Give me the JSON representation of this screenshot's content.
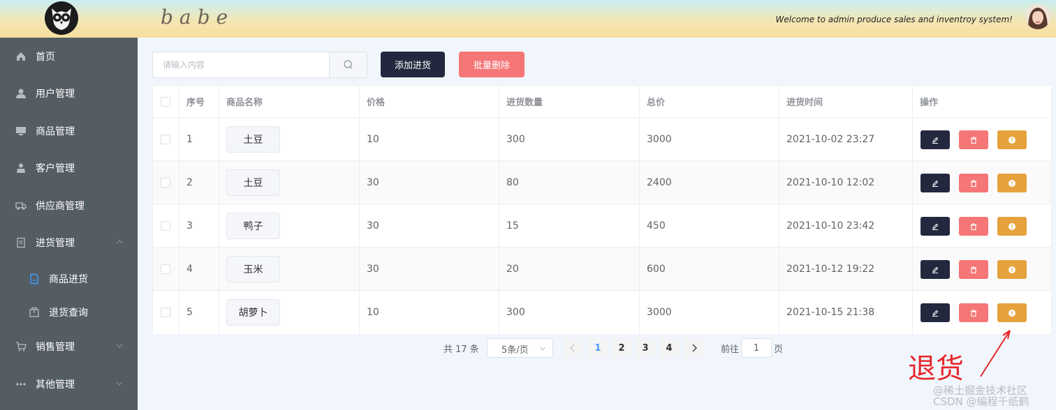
{
  "header": {
    "brand": "babe",
    "welcome": "Welcome to admin produce sales and inventroy system!"
  },
  "sidebar": {
    "items": [
      {
        "label": "首页",
        "icon": "home-icon"
      },
      {
        "label": "用户管理",
        "icon": "user-icon"
      },
      {
        "label": "商品管理",
        "icon": "monitor-icon"
      },
      {
        "label": "客户管理",
        "icon": "customer-icon"
      },
      {
        "label": "供应商管理",
        "icon": "truck-icon"
      },
      {
        "label": "进货管理",
        "icon": "document-icon",
        "expanded": true,
        "children": [
          {
            "label": "商品进货",
            "icon": "file-icon",
            "active": true
          },
          {
            "label": "退货查询",
            "icon": "box-icon"
          }
        ]
      },
      {
        "label": "销售管理",
        "icon": "cart-icon"
      },
      {
        "label": "其他管理",
        "icon": "more-icon"
      }
    ]
  },
  "toolbar": {
    "search_placeholder": "请输入内容",
    "add_label": "添加进货",
    "delete_label": "批量删除"
  },
  "table": {
    "headers": [
      "序号",
      "商品名称",
      "价格",
      "进货数量",
      "总价",
      "进货时间",
      "操作"
    ],
    "rows": [
      {
        "index": "1",
        "name": "土豆",
        "price": "10",
        "quantity": "300",
        "total": "3000",
        "time": "2021-10-02 23:27"
      },
      {
        "index": "2",
        "name": "土豆",
        "price": "30",
        "quantity": "80",
        "total": "2400",
        "time": "2021-10-10 12:02"
      },
      {
        "index": "3",
        "name": "鸭子",
        "price": "30",
        "quantity": "15",
        "total": "450",
        "time": "2021-10-10 23:42"
      },
      {
        "index": "4",
        "name": "玉米",
        "price": "30",
        "quantity": "20",
        "total": "600",
        "time": "2021-10-12 19:22"
      },
      {
        "index": "5",
        "name": "胡萝卜",
        "price": "10",
        "quantity": "300",
        "total": "3000",
        "time": "2021-10-15 21:38"
      }
    ]
  },
  "pagination": {
    "total": "共 17 条",
    "page_size": "5条/页",
    "pages": [
      "1",
      "2",
      "3",
      "4"
    ],
    "current_page": "1",
    "goto_label": "前往",
    "goto_value": "1",
    "page_suffix": "页"
  },
  "annotation": {
    "text": "退货",
    "color": "#e8262a"
  },
  "watermark": {
    "line1": "@稀土掘金技术社区",
    "line2": "CSDN @编程千纸鹤"
  },
  "colors": {
    "sidebar": "#545c64",
    "primary_dark": "#23283e",
    "danger": "#f57676",
    "warning": "#e6a23c",
    "active_page": "#409eff"
  }
}
